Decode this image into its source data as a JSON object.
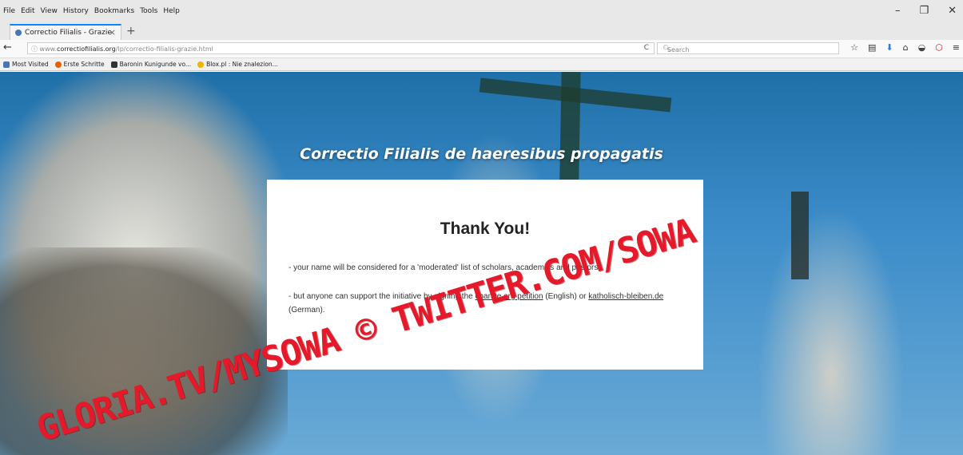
{
  "menubar": {
    "items": [
      "File",
      "Edit",
      "View",
      "History",
      "Bookmarks",
      "Tools",
      "Help"
    ]
  },
  "window_controls": {
    "minimize": "–",
    "restore": "❐",
    "close": "✕"
  },
  "tab": {
    "title": "Correctio Filialis - Grazie",
    "close": "×",
    "new_tab": "+"
  },
  "navbar": {
    "back": "←",
    "info": "ⓘ",
    "url_prefix": "www.",
    "url_domain": "correctiofilialis.org",
    "url_path": "/lp/correctio-filialis-grazie.html",
    "reload": "C",
    "search_placeholder": "Search",
    "icons": [
      "star-icon",
      "bookmark-list-icon",
      "download-icon",
      "home-icon",
      "pocket-icon",
      "ublock-icon",
      "menu-icon"
    ]
  },
  "bookmarks": [
    {
      "label": "Most Visited",
      "color": "#4a74b8"
    },
    {
      "label": "Erste Schritte",
      "color": "#e66000"
    },
    {
      "label": "Baronin Kunigunde vo...",
      "color": "#333333"
    },
    {
      "label": "Blox.pl : Nie znalezion...",
      "color": "#f2b400"
    }
  ],
  "page": {
    "headline": "Correctio Filialis de haeresibus propagatis",
    "card": {
      "title": "Thank You!",
      "line1": "- your name will be considered for a 'moderated' list of scholars, academics and pastors;",
      "line2_pre": "- but anyone can support the initiative by signing the ",
      "line2_link1": "change.org petition",
      "line2_mid": " (English) or ",
      "line2_link2": "katholisch-bleiben.de",
      "line2_post": " (German)."
    }
  },
  "watermark": "GLORIA.TV/MYSOWA © TWITTER.COM/SOWA"
}
